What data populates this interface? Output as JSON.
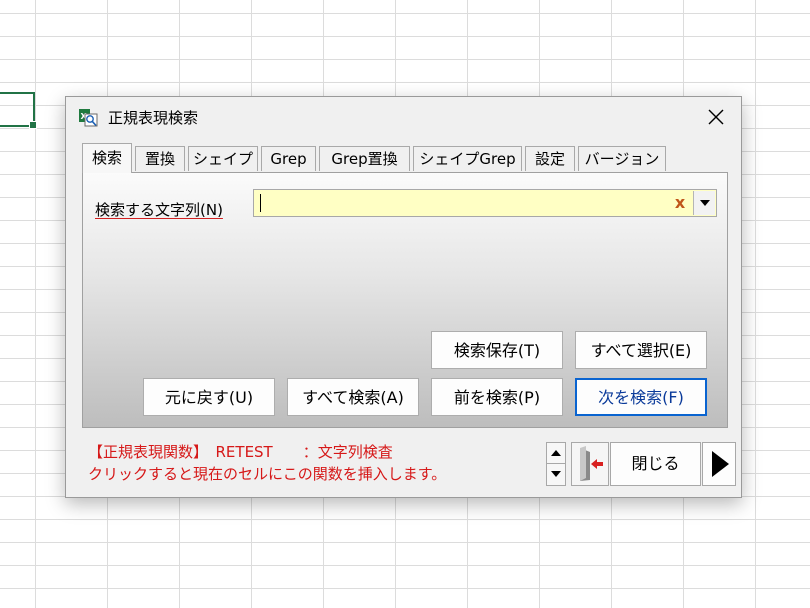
{
  "dialog": {
    "title": "正規表現検索",
    "close_glyph": "✕",
    "app_icon": "excel-search-icon"
  },
  "tabs": [
    {
      "label": "検索",
      "active": true
    },
    {
      "label": "置換",
      "active": false
    },
    {
      "label": "シェイプ",
      "active": false
    },
    {
      "label": "Grep",
      "active": false
    },
    {
      "label": "Grep置換",
      "active": false
    },
    {
      "label": "シェイプGrep",
      "active": false
    },
    {
      "label": "設定",
      "active": false
    },
    {
      "label": "バージョン",
      "active": false
    }
  ],
  "search": {
    "label": "検索する文字列(N)",
    "value": "",
    "clear_glyph": "x",
    "input_bg": "#ffffc4"
  },
  "buttons": {
    "save_search": "検索保存(T)",
    "select_all": "すべて選択(E)",
    "undo": "元に戻す(U)",
    "search_all": "すべて検索(A)",
    "search_prev": "前を検索(P)",
    "search_next": "次を検索(F)",
    "close": "閉じる"
  },
  "footer": {
    "line1": "【正規表現関数】　RETEST　　：文字列検査",
    "line2": "クリックすると現在のセルにこの関数を挿入します。",
    "text_color": "#d61818"
  },
  "icons": {
    "spin_up": "spin-up-icon",
    "spin_down": "spin-down-icon",
    "door": "exit-door-icon",
    "next": "play-next-icon"
  }
}
